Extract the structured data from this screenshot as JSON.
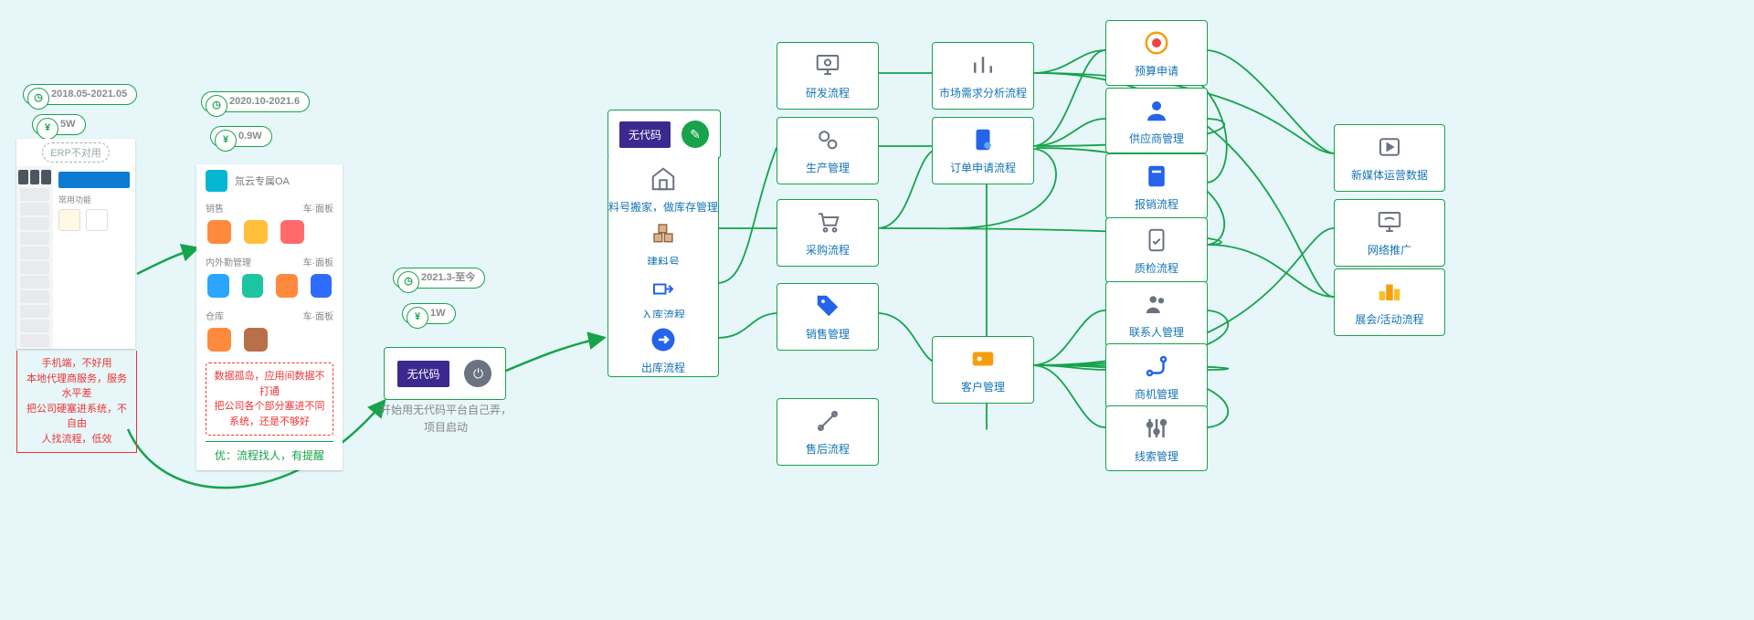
{
  "phase1": {
    "date": "2018.05-2021.05",
    "cost": "5W",
    "erp_note": "ERP不对用",
    "side_items": [
      "口口口",
      "口口口",
      "口口口",
      "口口口",
      "口口口",
      "口口口",
      "口口口",
      "口口口",
      "口口口",
      "口口口",
      "口口口"
    ],
    "main_head": "常用功能",
    "warning": "手机端，不好用\n本地代理商服务，服务水平差\n把公司硬塞进系统，不自由\n人找流程，低效"
  },
  "phase2": {
    "date": "2020.10-2021.6",
    "cost": "0.9W",
    "title": "氚云专属OA",
    "sec1": "销售",
    "sec1r": "车·面板",
    "sec2": "内外勤管理",
    "sec2r": "车·面板",
    "sec3": "仓库",
    "sec3r": "车·面板",
    "warning": "数据孤岛，应用间数据不打通\n把公司各个部分塞进不同系统，还是不够好",
    "ok": "优：流程找人，有提醒"
  },
  "phase3": {
    "date": "2021.3-至今",
    "cost": "1W",
    "tag": "无代码",
    "note": "开始用无代码平台自己弄，\n项目启动"
  },
  "col_a": {
    "a1_tag": "无代码",
    "a2": "料号搬家，做库存管理",
    "a3": "建料号",
    "a4": "入库流程",
    "a5": "出库流程"
  },
  "col_b": {
    "b1": "研发流程",
    "b2": "生产管理",
    "b3": "采购流程",
    "b4": "销售管理",
    "b5": "售后流程"
  },
  "col_c": {
    "c1": "市场需求分析流程",
    "c2": "订单申请流程",
    "c3": "客户管理"
  },
  "col_d": {
    "d1": "预算申请",
    "d2": "供应商管理",
    "d3": "报销流程",
    "d4": "质检流程",
    "d5": "联系人管理",
    "d6": "商机管理",
    "d7": "线索管理"
  },
  "col_e": {
    "e1": "新媒体运营数据",
    "e2": "网络推广",
    "e3": "展会/活动流程"
  }
}
